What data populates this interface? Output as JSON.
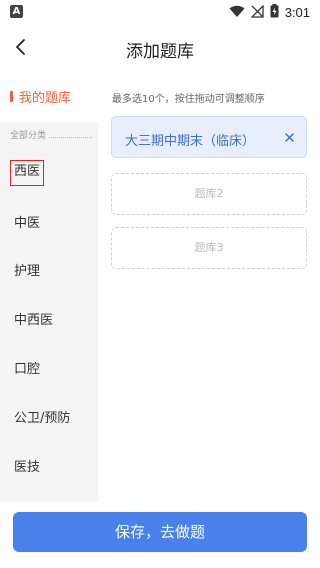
{
  "status_bar": {
    "app_badge": "A",
    "time": "3:01"
  },
  "header": {
    "title": "添加题库"
  },
  "sidebar": {
    "my_bank_label": "我的题库",
    "all_categories_label": "全部分类",
    "categories": [
      {
        "label": "西医",
        "selected": true
      },
      {
        "label": "中医",
        "selected": false
      },
      {
        "label": "护理",
        "selected": false
      },
      {
        "label": "中西医",
        "selected": false
      },
      {
        "label": "口腔",
        "selected": false
      },
      {
        "label": "公卫/预防",
        "selected": false
      },
      {
        "label": "医技",
        "selected": false
      }
    ]
  },
  "main": {
    "hint": "最多选10个，按住拖动可调整顺序",
    "selected_banks": [
      {
        "name": "大三期中期末（临床）"
      }
    ],
    "empty_slots": [
      "题库2",
      "题库3"
    ]
  },
  "footer": {
    "save_label": "保存，去做题"
  },
  "colors": {
    "accent_orange": "#f0623a",
    "primary_blue": "#4a80ea",
    "selected_text_blue": "#3d6fd6",
    "selection_outline": "#e02424"
  }
}
